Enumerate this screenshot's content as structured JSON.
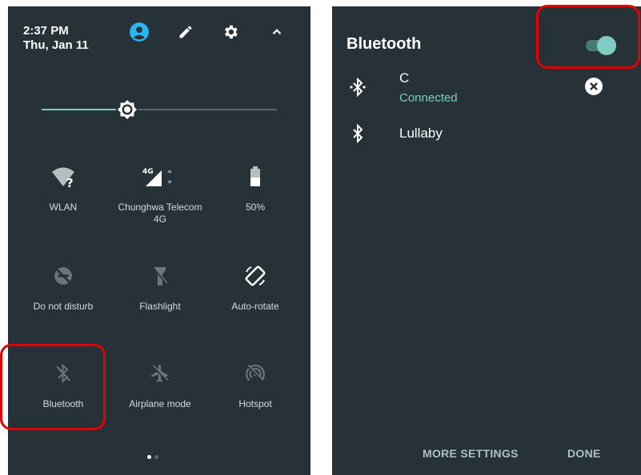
{
  "quick_settings": {
    "time": "2:37 PM",
    "date": "Thu, Jan 11",
    "header_icons": [
      "user-icon",
      "edit-icon",
      "settings-icon",
      "collapse-icon"
    ],
    "brightness_level": 0.37,
    "tiles": [
      {
        "label": "WLAN",
        "icon": "wifi-unknown-icon"
      },
      {
        "label": "Chunghwa Telecom 4G",
        "icon": "cellular-4g-icon"
      },
      {
        "label": "50%",
        "icon": "battery-icon"
      },
      {
        "label": "Do not disturb",
        "icon": "do-not-disturb-off-icon"
      },
      {
        "label": "Flashlight",
        "icon": "flashlight-off-icon"
      },
      {
        "label": "Auto-rotate",
        "icon": "auto-rotate-icon"
      },
      {
        "label": "Bluetooth",
        "icon": "bluetooth-off-icon"
      },
      {
        "label": "Airplane mode",
        "icon": "airplane-off-icon"
      },
      {
        "label": "Hotspot",
        "icon": "hotspot-off-icon"
      }
    ],
    "page_count": 2,
    "active_page": 1
  },
  "bluetooth_panel": {
    "title": "Bluetooth",
    "enabled": true,
    "devices": [
      {
        "name": "C",
        "status": "Connected"
      },
      {
        "name": "Lullaby",
        "status": ""
      }
    ],
    "more_settings_label": "MORE SETTINGS",
    "done_label": "DONE"
  },
  "colors": {
    "panel_bg": "#263238",
    "accent": "#80cbc4",
    "highlight": "#e30000"
  }
}
